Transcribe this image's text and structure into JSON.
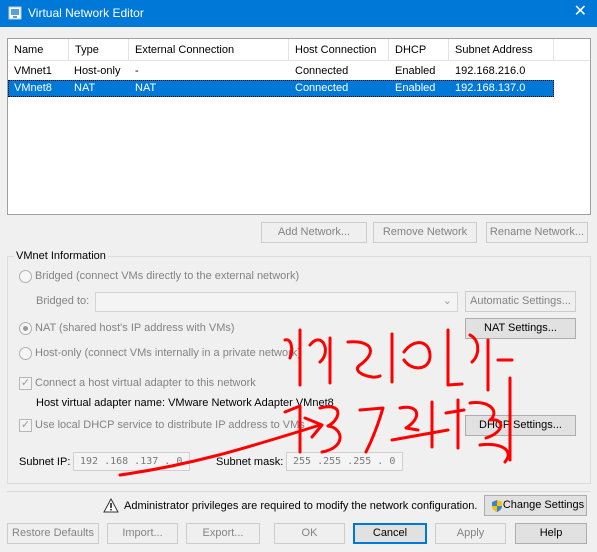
{
  "window": {
    "title": "Virtual Network Editor",
    "close_glyph": "✕"
  },
  "table": {
    "headers": [
      "Name",
      "Type",
      "External Connection",
      "Host Connection",
      "DHCP",
      "Subnet Address"
    ],
    "rows": [
      [
        "VMnet1",
        "Host-only",
        "-",
        "Connected",
        "Enabled",
        "192.168.216.0"
      ],
      [
        "VMnet8",
        "NAT",
        "NAT",
        "Connected",
        "Enabled",
        "192.168.137.0"
      ]
    ],
    "selected_row": 1
  },
  "table_buttons": {
    "add": "Add Network...",
    "remove": "Remove Network",
    "rename": "Rename Network..."
  },
  "vmnet_info": {
    "group_title": "VMnet Information",
    "bridged_label": "Bridged (connect VMs directly to the external network)",
    "bridged_to_label": "Bridged to:",
    "automatic_settings": "Automatic Settings...",
    "nat_label": "NAT (shared host's IP address with VMs)",
    "nat_settings": "NAT Settings...",
    "hostonly_label": "Host-only (connect VMs internally in a private network)",
    "connect_adapter_label": "Connect a host virtual adapter to this network",
    "adapter_name_label": "Host virtual adapter name: VMware Network Adapter VMnet8",
    "use_dhcp_label": "Use local DHCP service to distribute IP address to VMs",
    "dhcp_settings": "DHCP Settings...",
    "subnet_ip_label": "Subnet IP:",
    "subnet_ip": "192 .168 .137 .  0",
    "subnet_mask_label": "Subnet mask:",
    "subnet_mask": "255 .255 .255 .  0",
    "selected_mode": "NAT",
    "connect_adapter_checked": true,
    "use_dhcp_checked": true
  },
  "admin": {
    "message": "Administrator privileges are required to modify the network configuration.",
    "change_settings": "Change Settings"
  },
  "footer": {
    "restore": "Restore Defaults",
    "import": "Import...",
    "export": "Export...",
    "ok": "OK",
    "cancel": "Cancel",
    "apply": "Apply",
    "help": "Help"
  },
  "colors": {
    "accent": "#0078d7",
    "annotation": "#ff0000"
  },
  "icons": {
    "title": "vmware-network-icon",
    "warning": "warning-icon",
    "shield": "uac-shield-icon"
  }
}
